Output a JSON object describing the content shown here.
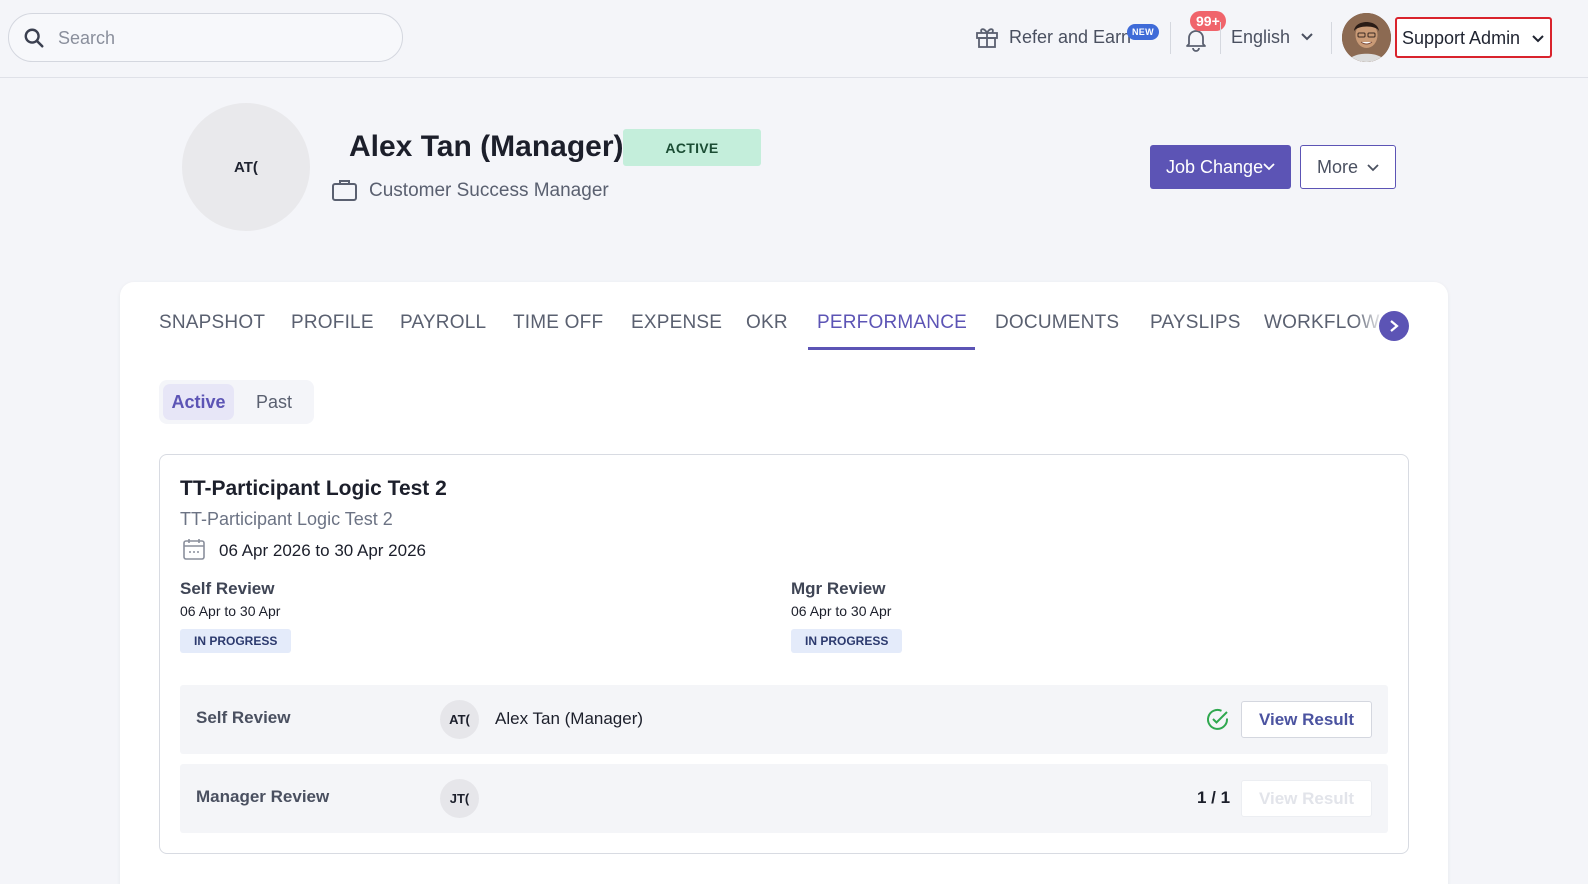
{
  "topbar": {
    "search_placeholder": "Search",
    "refer_label": "Refer and Earn",
    "refer_badge": "NEW",
    "notification_badge": "99+",
    "language": "English",
    "user_menu": "Support Admin"
  },
  "profile": {
    "initials": "AT(",
    "name": "Alex Tan (Manager)",
    "status": "ACTIVE",
    "job_title": "Customer Success Manager",
    "job_change_label": "Job Change",
    "more_label": "More"
  },
  "tabs": [
    "SNAPSHOT",
    "PROFILE",
    "PAYROLL",
    "TIME OFF",
    "EXPENSE",
    "OKR",
    "PERFORMANCE",
    "DOCUMENTS",
    "PAYSLIPS",
    "WORKFLOW"
  ],
  "active_tab": "PERFORMANCE",
  "segment": {
    "active": "Active",
    "past": "Past"
  },
  "review_cycle": {
    "title": "TT-Participant Logic Test 2",
    "subtitle": "TT-Participant Logic Test 2",
    "dates": "06 Apr 2026 to 30 Apr 2026",
    "phases": [
      {
        "title": "Self Review",
        "dates": "06 Apr to 30 Apr",
        "status": "IN PROGRESS"
      },
      {
        "title": "Mgr Review",
        "dates": "06 Apr to 30 Apr",
        "status": "IN PROGRESS"
      }
    ],
    "rows": [
      {
        "label": "Self Review",
        "initials": "AT(",
        "person": "Alex Tan (Manager)",
        "progress": "",
        "completed": true,
        "action": "View Result"
      },
      {
        "label": "Manager Review",
        "initials": "JT(",
        "person": "",
        "progress": "1 / 1",
        "completed": false,
        "action": "View Result"
      }
    ]
  },
  "colors": {
    "accent": "#5c54b5",
    "active_badge": "#c4eedb",
    "highlight_border": "#d9232d",
    "success": "#2fa84f"
  }
}
